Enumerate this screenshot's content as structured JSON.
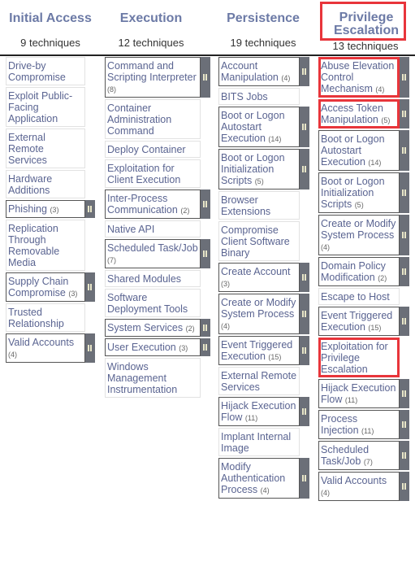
{
  "tactics": [
    {
      "title": "Initial Access",
      "count": "9 techniques",
      "techniques": [
        {
          "name": "Drive-by Compromise",
          "sub": null
        },
        {
          "name": "Exploit Public-Facing Application",
          "sub": null
        },
        {
          "name": "External Remote Services",
          "sub": null
        },
        {
          "name": "Hardware Additions",
          "sub": null
        },
        {
          "name": "Phishing",
          "sub": "(3)"
        },
        {
          "name": "Replication Through Removable Media",
          "sub": null
        },
        {
          "name": "Supply Chain Compromise",
          "sub": "(3)"
        },
        {
          "name": "Trusted Relationship",
          "sub": null
        },
        {
          "name": "Valid Accounts",
          "sub": "(4)"
        }
      ]
    },
    {
      "title": "Execution",
      "count": "12 techniques",
      "techniques": [
        {
          "name": "Command and Scripting Interpreter",
          "sub": "(8)"
        },
        {
          "name": "Container Administration Command",
          "sub": null
        },
        {
          "name": "Deploy Container",
          "sub": null
        },
        {
          "name": "Exploitation for Client Execution",
          "sub": null
        },
        {
          "name": "Inter-Process Communication",
          "sub": "(2)"
        },
        {
          "name": "Native API",
          "sub": null
        },
        {
          "name": "Scheduled Task/Job",
          "sub": "(7)"
        },
        {
          "name": "Shared Modules",
          "sub": null
        },
        {
          "name": "Software Deployment Tools",
          "sub": null
        },
        {
          "name": "System Services",
          "sub": "(2)"
        },
        {
          "name": "User Execution",
          "sub": "(3)"
        },
        {
          "name": "Windows Management Instrumentation",
          "sub": null
        }
      ]
    },
    {
      "title": "Persistence",
      "count": "19 techniques",
      "techniques": [
        {
          "name": "Account Manipulation",
          "sub": "(4)"
        },
        {
          "name": "BITS Jobs",
          "sub": null
        },
        {
          "name": "Boot or Logon Autostart Execution",
          "sub": "(14)"
        },
        {
          "name": "Boot or Logon Initialization Scripts",
          "sub": "(5)"
        },
        {
          "name": "Browser Extensions",
          "sub": null
        },
        {
          "name": "Compromise Client Software Binary",
          "sub": null
        },
        {
          "name": "Create Account",
          "sub": "(3)"
        },
        {
          "name": "Create or Modify System Process",
          "sub": "(4)"
        },
        {
          "name": "Event Triggered Execution",
          "sub": "(15)"
        },
        {
          "name": "External Remote Services",
          "sub": null
        },
        {
          "name": "Hijack Execution Flow",
          "sub": "(11)"
        },
        {
          "name": "Implant Internal Image",
          "sub": null
        },
        {
          "name": "Modify Authentication Process",
          "sub": "(4)"
        }
      ]
    },
    {
      "title": "Privilege Escalation",
      "count": "13 techniques",
      "techniques": [
        {
          "name": "Abuse Elevation Control Mechanism",
          "sub": "(4)",
          "highlight": true
        },
        {
          "name": "Access Token Manipulation",
          "sub": "(5)",
          "highlight": true
        },
        {
          "name": "Boot or Logon Autostart Execution",
          "sub": "(14)"
        },
        {
          "name": "Boot or Logon Initialization Scripts",
          "sub": "(5)"
        },
        {
          "name": "Create or Modify System Process",
          "sub": "(4)"
        },
        {
          "name": "Domain Policy Modification",
          "sub": "(2)"
        },
        {
          "name": "Escape to Host",
          "sub": null
        },
        {
          "name": "Event Triggered Execution",
          "sub": "(15)"
        },
        {
          "name": "Exploitation for Privilege Escalation",
          "sub": null,
          "highlight": true
        },
        {
          "name": "Hijack Execution Flow",
          "sub": "(11)"
        },
        {
          "name": "Process Injection",
          "sub": "(11)"
        },
        {
          "name": "Scheduled Task/Job",
          "sub": "(7)"
        },
        {
          "name": "Valid Accounts",
          "sub": "(4)"
        }
      ]
    }
  ],
  "colors": {
    "highlight": "#e8353b",
    "handle": "#6b6f78",
    "title": "#6c7aa6",
    "text": "#5a6491"
  }
}
